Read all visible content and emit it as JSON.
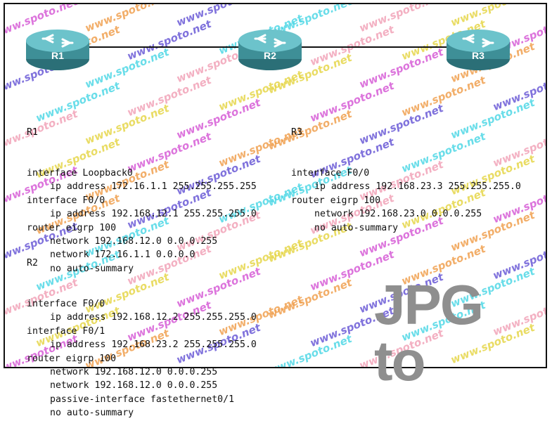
{
  "topology": {
    "routers": [
      {
        "id": "R1",
        "label": "R1"
      },
      {
        "id": "R2",
        "label": "R2"
      },
      {
        "id": "R3",
        "label": "R3"
      }
    ],
    "links": [
      {
        "from": "R1",
        "to": "R2"
      },
      {
        "from": "R2",
        "to": "R3"
      }
    ]
  },
  "configs": {
    "r1": {
      "title": "R1",
      "lines": [
        {
          "text": "interface Loopback0",
          "indent": 0
        },
        {
          "text": "ip address 172.16.1.1 255.255.255.255",
          "indent": 1
        },
        {
          "text": "interface F0/0",
          "indent": 0
        },
        {
          "text": "ip address 192.168.12.1 255.255.255.0",
          "indent": 1
        },
        {
          "text": "router eigrp 100",
          "indent": 0
        },
        {
          "text": "network 192.168.12.0 0.0.0.255",
          "indent": 1
        },
        {
          "text": "network 172.16.1.1 0.0.0.0",
          "indent": 1
        },
        {
          "text": "no auto-summary",
          "indent": 1
        }
      ]
    },
    "r2": {
      "title": "R2",
      "lines": [
        {
          "text": "interface F0/0",
          "indent": 0
        },
        {
          "text": "ip address 192.168.12.2 255.255.255.0",
          "indent": 1
        },
        {
          "text": "interface F0/1",
          "indent": 0
        },
        {
          "text": "ip address 192.168.23.2 255.255.255.0",
          "indent": 1
        },
        {
          "text": "router eigrp 100",
          "indent": 0
        },
        {
          "text": "network 192.168.12.0 0.0.0.255",
          "indent": 1
        },
        {
          "text": "network 192.168.12.0 0.0.0.255",
          "indent": 1
        },
        {
          "text": "passive-interface fastethernet0/1",
          "indent": 1
        },
        {
          "text": "no auto-summary",
          "indent": 1
        }
      ]
    },
    "r3": {
      "title": "R3",
      "lines": [
        {
          "text": "interface F0/0",
          "indent": 0
        },
        {
          "text": "ip address 192.168.23.3 255.255.255.0",
          "indent": 1
        },
        {
          "text": "router eigrp 100",
          "indent": 0
        },
        {
          "text": "network 192.168.23.0 0.0.0.255",
          "indent": 1
        },
        {
          "text": "no auto-summary",
          "indent": 1
        }
      ]
    }
  },
  "watermark": {
    "text": "www.spoto.net",
    "colors": [
      "#d65cd6",
      "#f0a050",
      "#6a5ad6",
      "#4fd8e6",
      "#f2a3b8",
      "#e6d64a"
    ]
  },
  "badge": {
    "text": "JPG to"
  },
  "colors": {
    "router_body": "#3e8f97",
    "router_top": "#6cc3cb",
    "router_edge": "#2b6f77",
    "line": "#111111"
  }
}
